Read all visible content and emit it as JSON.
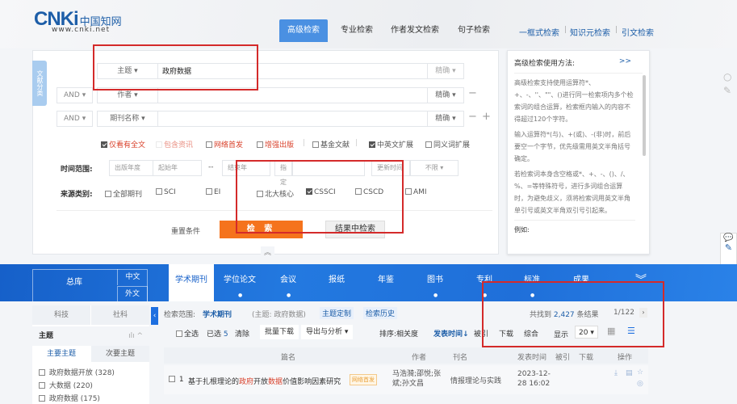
{
  "header": {
    "logo_text": "CNKi",
    "logo_cn": "中国知网",
    "logo_url": "www.cnki.net",
    "tabs": [
      "高级检索",
      "专业检索",
      "作者发文检索",
      "句子检索"
    ],
    "links": [
      "一框式检索",
      "知识元检索",
      "引文检索"
    ]
  },
  "search": {
    "side_tab": "文献分类",
    "rows": [
      {
        "logic": "",
        "field": "主题",
        "value": "政府数据",
        "match": "精确"
      },
      {
        "logic": "AND",
        "field": "作者",
        "value": "",
        "match": "精确"
      },
      {
        "logic": "AND",
        "field": "期刊名称",
        "value": "",
        "match": "精确"
      }
    ],
    "options": [
      {
        "label": "仅看有全文",
        "checked": true,
        "red": true
      },
      {
        "label": "包含资讯",
        "checked": false,
        "red": true
      },
      {
        "label": "网络首发",
        "checked": false,
        "red": true
      },
      {
        "label": "增强出版",
        "checked": false,
        "red": true
      },
      {
        "label": "基金文献",
        "checked": false,
        "red": false
      },
      {
        "label": "中英文扩展",
        "checked": true,
        "red": false
      },
      {
        "label": "同义词扩展",
        "checked": false,
        "red": false
      }
    ],
    "time_label": "时间范围:",
    "pub_year": "出版年度",
    "start_year": "起始年",
    "dash": "--",
    "end_year": "结束年",
    "specify": "指定",
    "update_time": "更新时间",
    "unlimited": "不限",
    "source_label": "来源类别:",
    "sources": [
      {
        "label": "全部期刊",
        "checked": false
      },
      {
        "label": "SCI",
        "checked": false
      },
      {
        "label": "EI",
        "checked": false
      },
      {
        "label": "北大核心",
        "checked": false
      },
      {
        "label": "CSSCI",
        "checked": true
      },
      {
        "label": "CSCD",
        "checked": false
      },
      {
        "label": "AMI",
        "checked": false
      }
    ],
    "reset": "重置条件",
    "search_btn": "检 索",
    "within_btn": "结果中检索",
    "collapse": "︽"
  },
  "help": {
    "title": "高级检索使用方法:",
    "more": ">>",
    "paragraphs": [
      "高级检索支持使用运算符*、+、-、''、\"\"、()进行同一检索项内多个检索词的组合运算，检索框内输入的内容不得超过120个字符。",
      "输入运算符*(与)、+(或)、-(非)时，前后要空一个字节，优先级需用英文半角括号确定。",
      "若检索词本身含空格或*、+、-、()、/、%、=等特殊符号，进行多词组合运算时，为避免歧义，须将检索词用英文半角单引号或英文半角双引号引起来。",
      "例如:"
    ]
  },
  "nav": {
    "all": "总库",
    "zh": "中文",
    "en": "外文",
    "items": [
      "学术期刊",
      "学位论文",
      "会议",
      "报纸",
      "年鉴",
      "图书",
      "专利",
      "标准",
      "成果"
    ],
    "more": "︾"
  },
  "sidebar": {
    "tabs": [
      "科技",
      "社科"
    ],
    "section": "主题",
    "subtabs": [
      "主要主题",
      "次要主题"
    ],
    "items": [
      {
        "label": "政府数据开放 (328)"
      },
      {
        "label": "大数据 (220)"
      },
      {
        "label": "政府数据 (175)"
      }
    ]
  },
  "results": {
    "scope_label": "检索范围:",
    "scope": "学术期刊",
    "query": "(主题: 政府数据)",
    "topic_custom": "主题定制",
    "history": "检索历史",
    "found_prefix": "共找到",
    "count": "2,427",
    "found_suffix": "条结果",
    "page": "1/122",
    "select_all": "全选",
    "selected": "已选",
    "selected_count": "5",
    "clear": "清除",
    "batch_download": "批量下载",
    "export": "导出与分析 ▾",
    "sort_label": "排序:",
    "sort_options": [
      "相关度",
      "发表时间↓",
      "被引",
      "下载",
      "综合"
    ],
    "show_label": "显示",
    "page_size": "20 ▾",
    "columns": [
      "篇名",
      "作者",
      "刊名",
      "发表时间",
      "被引",
      "下载",
      "操作"
    ],
    "rows": [
      {
        "num": "1",
        "title_parts": [
          "基于扎根理论的",
          "政府",
          "开放",
          "数据",
          "价值影响因素研究"
        ],
        "badge": "网络首发",
        "authors": "马浩漪;邵悦;张斌;孙文昌",
        "journal": "情报理论与实践",
        "date": "2023-12-28 16:02"
      }
    ]
  }
}
